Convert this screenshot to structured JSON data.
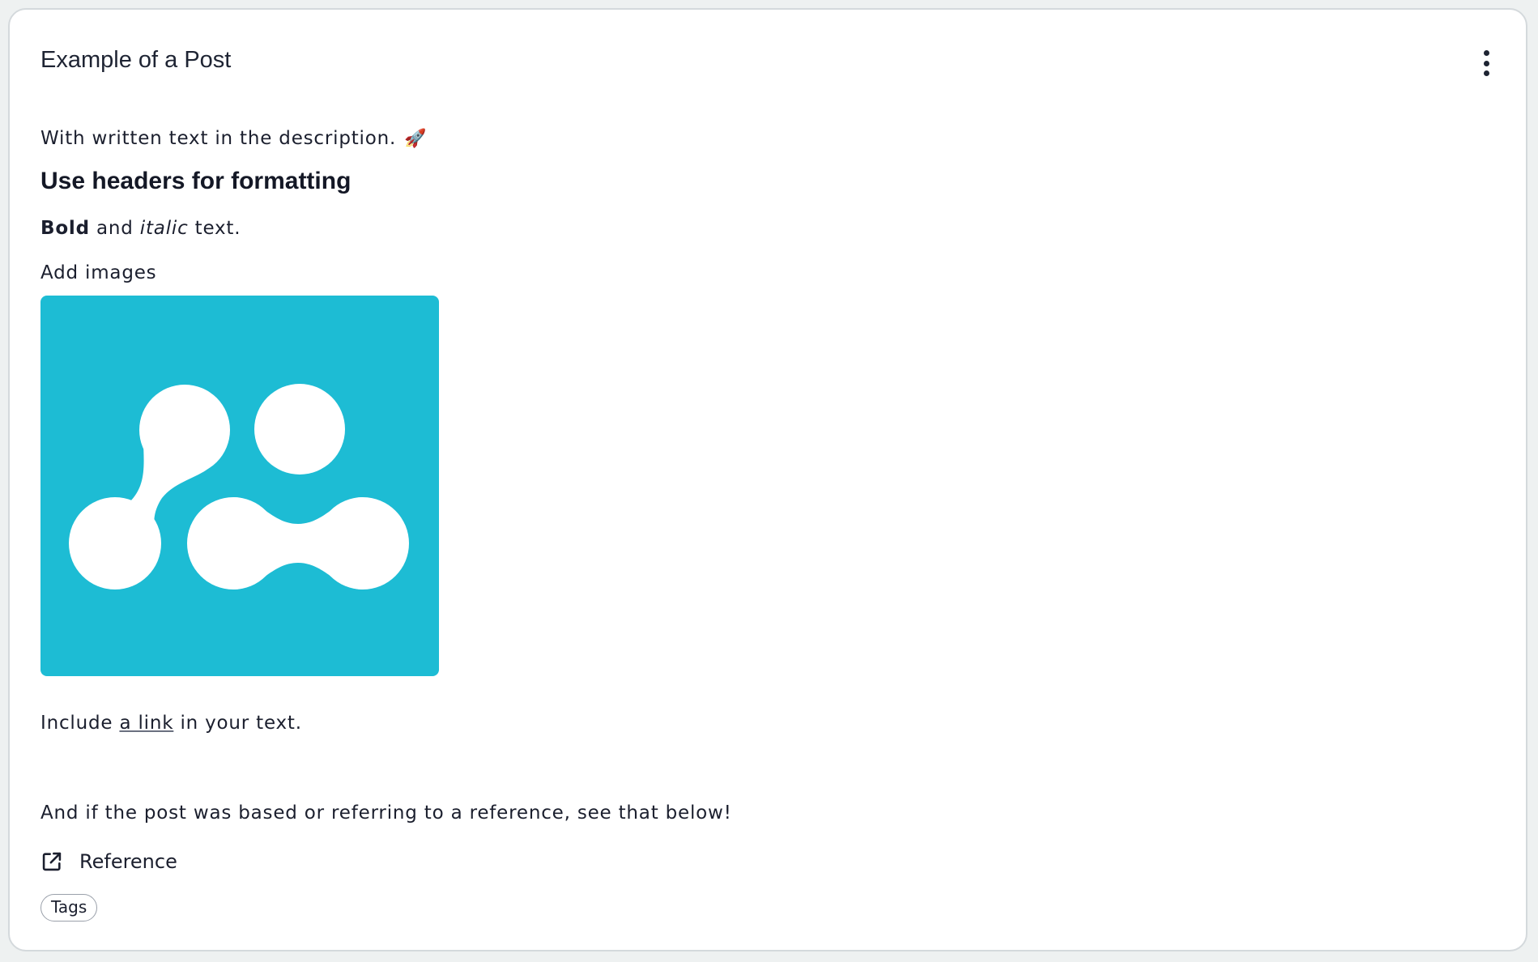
{
  "post": {
    "title": "Example of a Post",
    "menu_icon": "more-vertical-icon",
    "description": "With written text in the description.",
    "description_emoji": "🚀",
    "heading": "Use headers for formatting",
    "bold_text": "Bold",
    "and_text": " and ",
    "italic_text": "italic",
    "text_suffix": " text.",
    "images_label": "Add images",
    "image_icon": "logo-image",
    "image_background": "#1dbcd4",
    "link_prefix": "Include ",
    "link_text": "a link",
    "link_suffix": " in your text.",
    "reference_note": "And if the post was based or referring to a reference, see that below!",
    "reference": {
      "icon": "external-link-icon",
      "label": "Reference"
    },
    "tags": [
      "Tags"
    ]
  }
}
